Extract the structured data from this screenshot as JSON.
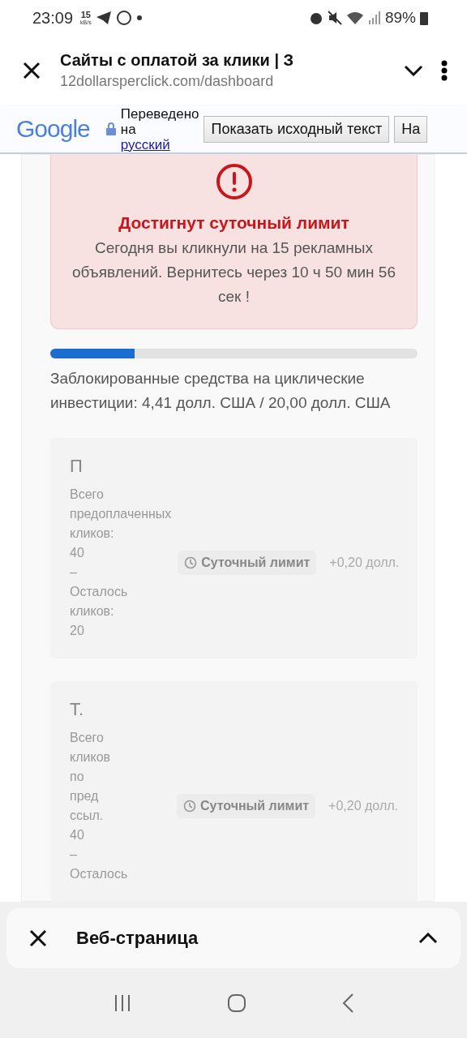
{
  "status_bar": {
    "time": "23:09",
    "speed_value": "15",
    "speed_unit": "kB/s",
    "battery": "89%"
  },
  "browser_header": {
    "title": "Сайты с оплатой за клики | З",
    "url": "12dollarsperclick.com/dashboard"
  },
  "translate_bar": {
    "brand": "Google",
    "lines": [
      "Переведено",
      "на",
      "русский"
    ],
    "buttons": [
      "Показать исходный текст",
      "На"
    ]
  },
  "alert": {
    "title": "Достигнут суточный лимит",
    "message": "Сегодня вы кликнули на 15 рекламных объявлений. Вернитесь через 10 ч 50 мин 56 сек !"
  },
  "locked_funds": {
    "level": 0.23,
    "text": "Заблокированные средства на циклические инвестиции: 4,41 долл. США / 20,00 долл. США"
  },
  "ads": [
    {
      "letter": "П",
      "lines": [
        "Всего",
        "предоплаченных",
        "кликов:",
        "40",
        "–",
        "Осталось",
        "кликов:",
        "20"
      ],
      "badge": "Суточный лимит",
      "reward": "+0,20 долл."
    },
    {
      "letter": "Т.",
      "lines": [
        "Всего",
        "кликов",
        "по",
        "пред",
        "ссыл.",
        "40",
        "–",
        "Осталось"
      ],
      "badge": "Суточный лимит",
      "reward": "+0,20 долл."
    }
  ],
  "bottom_sheet": {
    "title": "Веб-страница"
  }
}
